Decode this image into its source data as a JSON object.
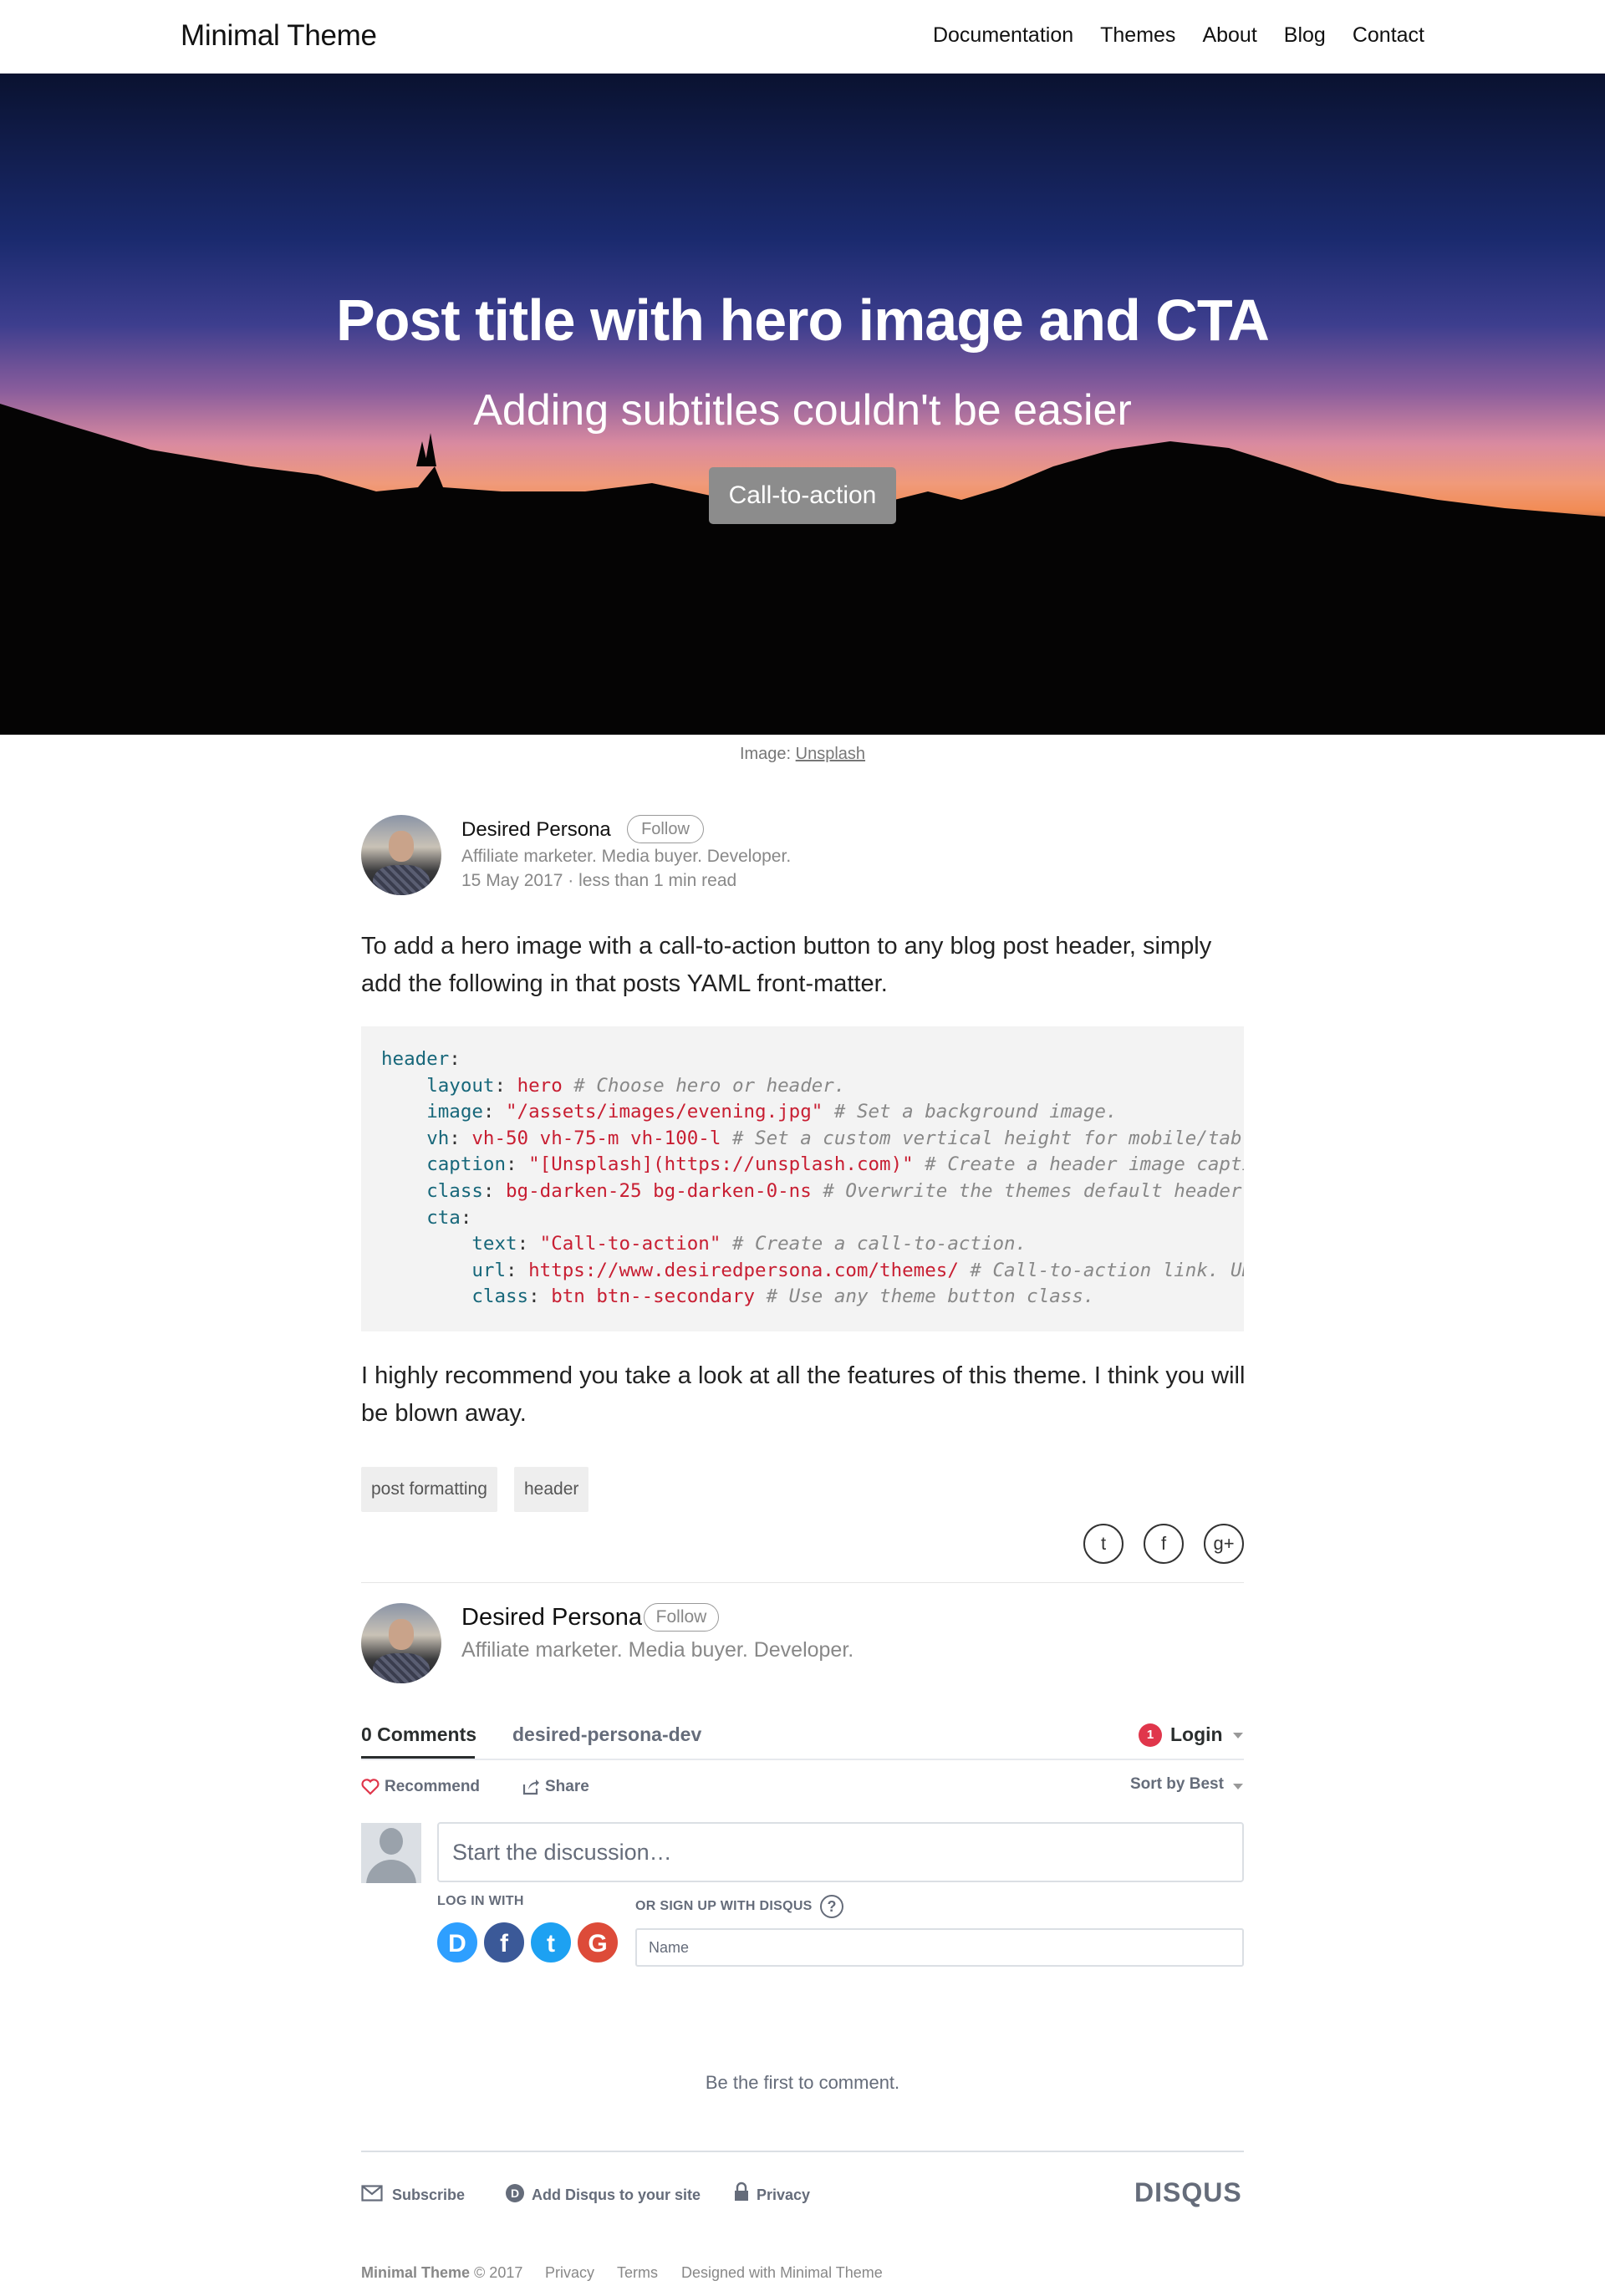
{
  "nav": {
    "brand": "Minimal Theme",
    "links": [
      "Documentation",
      "Themes",
      "About",
      "Blog",
      "Contact"
    ]
  },
  "hero": {
    "title": "Post title with hero image and CTA",
    "subtitle": "Adding subtitles couldn't be easier",
    "cta_label": "Call-to-action",
    "caption_prefix": "Image:",
    "caption_link": "Unsplash"
  },
  "author": {
    "name": "Desired Persona",
    "follow_label": "Follow",
    "bio": "Affiliate marketer. Media buyer. Developer.",
    "date": "15 May 2017",
    "read_time": "less than 1 min read",
    "meta_separator": "·"
  },
  "post": {
    "intro": "To add a hero image with a call-to-action button to any blog post header, simply add the following in that posts YAML front-matter.",
    "outro": "I highly recommend you take a look at all the features of this theme. I think you will be blown away.",
    "code": [
      {
        "indent": "",
        "key": "header",
        "value": "",
        "comment": ""
      },
      {
        "indent": "    ",
        "key": "layout",
        "value": "hero",
        "comment": "# Choose hero or header."
      },
      {
        "indent": "    ",
        "key": "image",
        "value": "\"/assets/images/evening.jpg\"",
        "comment": "# Set a background image."
      },
      {
        "indent": "    ",
        "key": "vh",
        "value": "vh-50 vh-75-m vh-100-l",
        "comment": "# Set a custom vertical height for mobile/tablet/desktop."
      },
      {
        "indent": "    ",
        "key": "caption",
        "value": "\"[Unsplash](https://unsplash.com)\"",
        "comment": "# Create a header image caption."
      },
      {
        "indent": "    ",
        "key": "class",
        "value": "bg-darken-25 bg-darken-0-ns",
        "comment": "# Overwrite the themes default header class."
      },
      {
        "indent": "    ",
        "key": "cta",
        "value": "",
        "comment": ""
      },
      {
        "indent": "        ",
        "key": "text",
        "value": "\"Call-to-action\"",
        "comment": "# Create a call-to-action."
      },
      {
        "indent": "        ",
        "key": "url",
        "value": "https://www.desiredpersona.com/themes/",
        "comment": "# Call-to-action link. URL's"
      },
      {
        "indent": "        ",
        "key": "class",
        "value": "btn btn--secondary",
        "comment": "# Use any theme button class."
      }
    ],
    "tags": [
      "post formatting",
      "header"
    ]
  },
  "share": {
    "icons": [
      "twitter-icon",
      "facebook-icon",
      "google-plus-icon"
    ],
    "glyphs": [
      "t",
      "f",
      "g+"
    ]
  },
  "disqus": {
    "tab_comments": "0 Comments",
    "tab_site": "desired-persona-dev",
    "notification_count": "1",
    "login_label": "Login",
    "recommend_label": "Recommend",
    "share_label": "Share",
    "sort_label": "Sort by Best",
    "discussion_placeholder": "Start the discussion…",
    "log_in_with": "LOG IN WITH",
    "or_sign_up": "OR SIGN UP WITH DISQUS",
    "help_glyph": "?",
    "name_placeholder": "Name",
    "social": [
      {
        "name": "disqus",
        "glyph": "D",
        "color": "#2e9fff"
      },
      {
        "name": "facebook",
        "glyph": "f",
        "color": "#3b5998"
      },
      {
        "name": "twitter",
        "glyph": "t",
        "color": "#1da1f2"
      },
      {
        "name": "google",
        "glyph": "G",
        "color": "#dd4b39"
      }
    ],
    "empty_text": "Be the first to comment.",
    "footer_subscribe": "Subscribe",
    "footer_add": "Add Disqus to your site",
    "footer_privacy": "Privacy",
    "logo": "DISQUS"
  },
  "footer": {
    "brand": "Minimal Theme",
    "copyright": "© 2017",
    "privacy": "Privacy",
    "terms": "Terms",
    "designed": "Designed with Minimal Theme"
  },
  "colors": {
    "cta_bg": "#8c8c8c",
    "code_key": "#17677a",
    "code_string": "#c81e32",
    "code_comment": "#888888",
    "disqus_badge": "#e0364b",
    "disqus_heart": "#e0364b"
  }
}
